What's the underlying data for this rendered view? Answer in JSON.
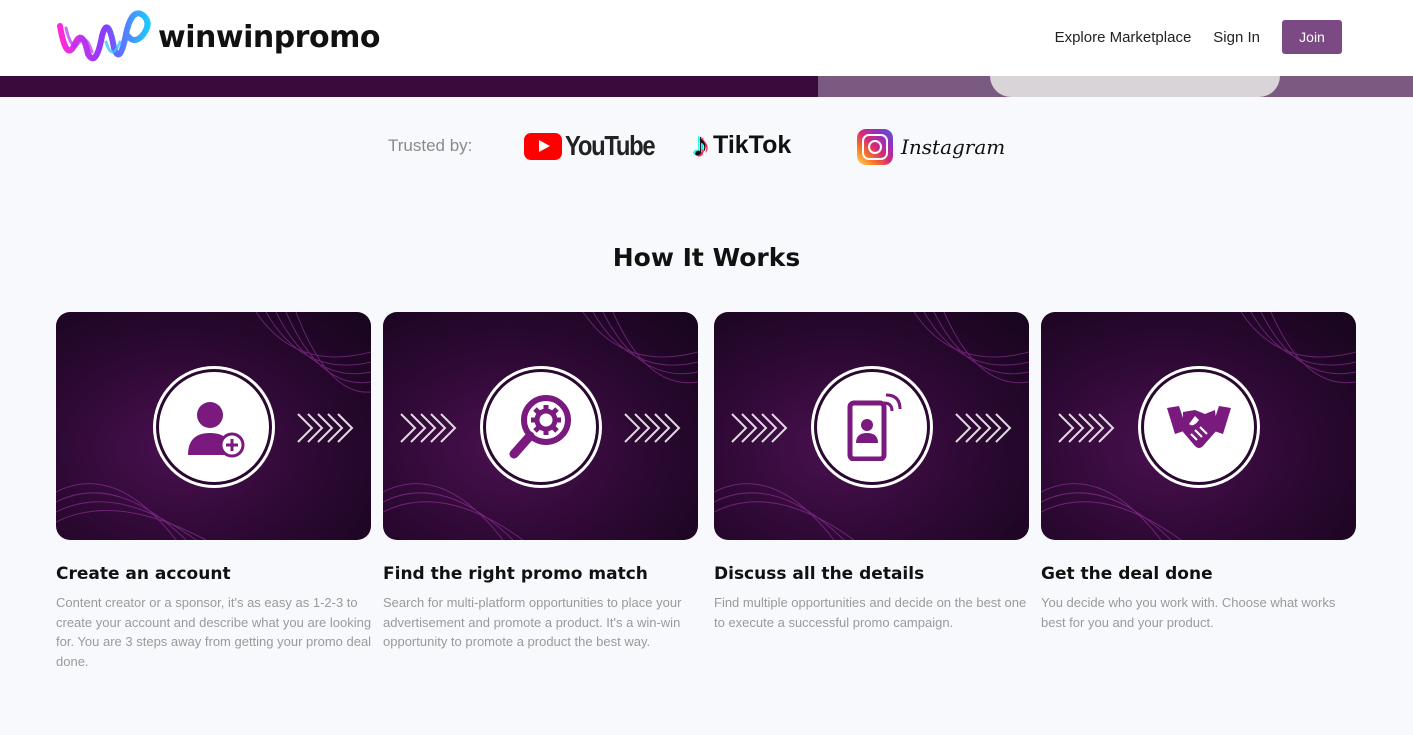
{
  "brand": {
    "name": "winwinpromo"
  },
  "nav": {
    "explore": "Explore Marketplace",
    "signin": "Sign In",
    "join": "Join"
  },
  "trusted": {
    "label": "Trusted by:",
    "logos": [
      "YouTube",
      "TikTok",
      "Instagram"
    ]
  },
  "how": {
    "title": "How It Works",
    "steps": [
      {
        "title": "Create an account",
        "icon": "add-user-icon",
        "desc": "Content creator or a sponsor, it's as easy as 1-2-3 to create your account and describe what you are looking for. You are 3 steps away from getting your promo deal done."
      },
      {
        "title": "Find the right promo match",
        "icon": "search-gear-icon",
        "desc": "Search for multi-platform opportunities to place your advertisement and promote a product. It's a win-win opportunity to promote a product the best way."
      },
      {
        "title": "Discuss all the details",
        "icon": "phone-contact-icon",
        "desc": "Find multiple opportunities and decide on the best one to execute a successful promo campaign."
      },
      {
        "title": "Get the deal done",
        "icon": "handshake-icon",
        "desc": "You decide who you work with. Choose what works best for you and your product."
      }
    ]
  },
  "colors": {
    "accent": "#7b4a84",
    "card_dark": "#2a0830",
    "icon_purple": "#7a1a7e"
  }
}
